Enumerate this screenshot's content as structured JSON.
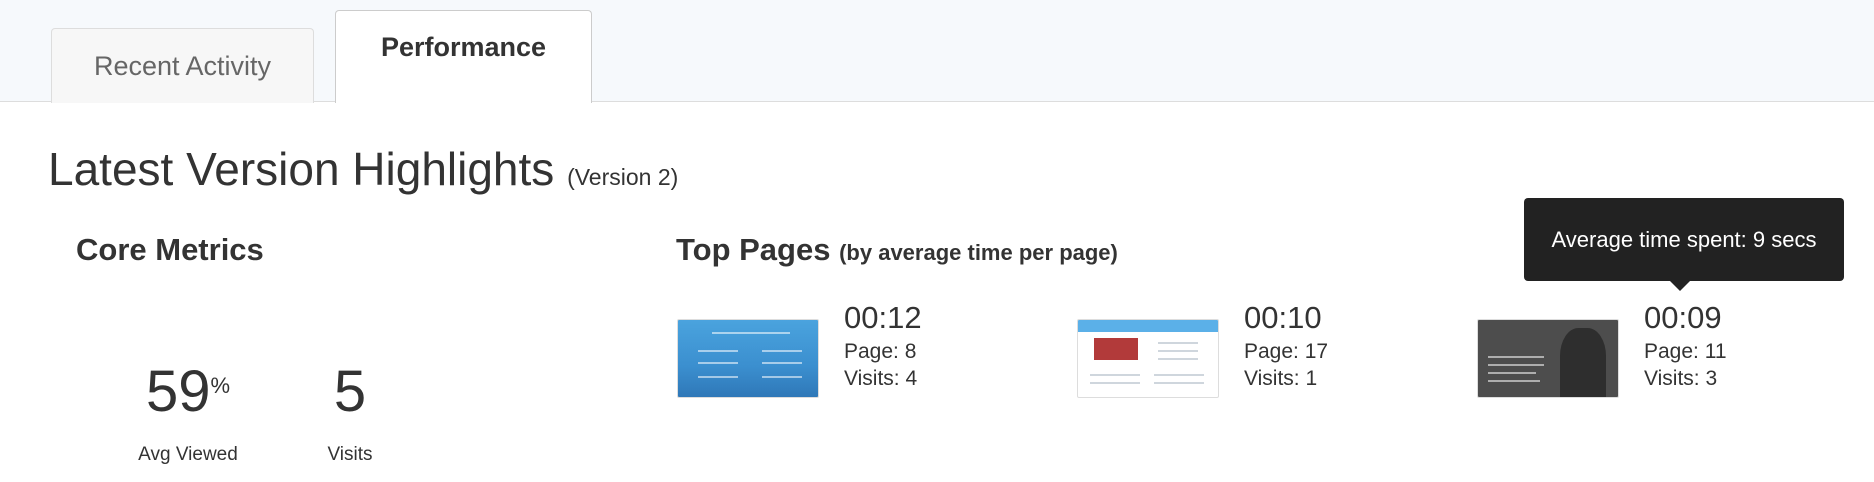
{
  "tabs": [
    {
      "label": "Recent Activity",
      "active": false
    },
    {
      "label": "Performance",
      "active": true
    }
  ],
  "page": {
    "title": "Latest Version Highlights",
    "version": "(Version 2)"
  },
  "core_metrics": {
    "title": "Core Metrics",
    "avg_viewed_value": "59",
    "avg_viewed_unit": "%",
    "avg_viewed_label": "Avg Viewed",
    "visits_value": "5",
    "visits_label": "Visits"
  },
  "top_pages": {
    "title": "Top Pages",
    "subtitle": "(by average time per page)",
    "items": [
      {
        "time": "00:12",
        "page": "Page: 8",
        "visits": "Visits: 4"
      },
      {
        "time": "00:10",
        "page": "Page: 17",
        "visits": "Visits: 1"
      },
      {
        "time": "00:09",
        "page": "Page: 11",
        "visits": "Visits: 3"
      }
    ]
  },
  "tooltip": {
    "text": "Average time spent: 9 secs"
  },
  "colors": {
    "tab_bar_bg": "#f6f9fc",
    "tooltip_bg": "#222222",
    "text": "#333333"
  }
}
